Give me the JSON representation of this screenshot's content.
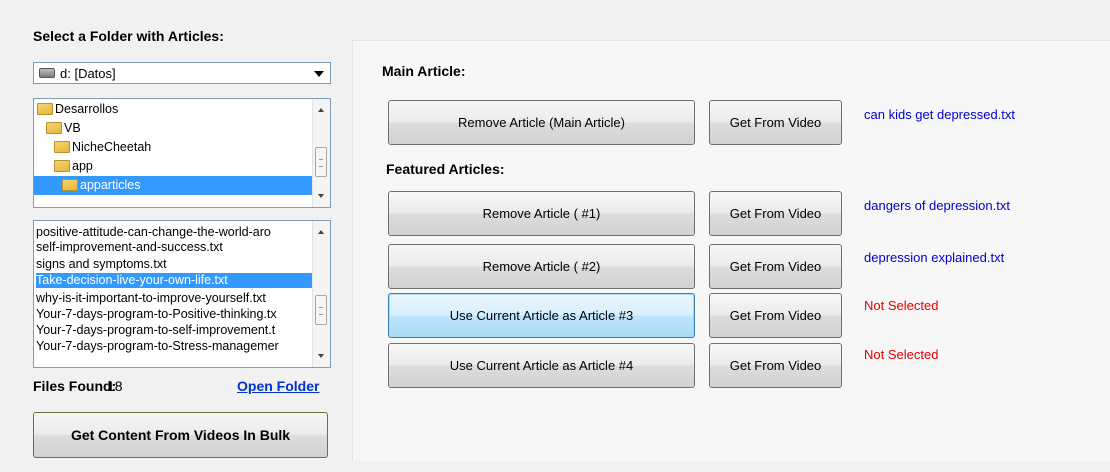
{
  "left": {
    "folder_title": "Select a Folder with Articles:",
    "drive": "d: [Datos]",
    "folders": [
      "Desarrollos",
      "VB",
      "NicheCheetah",
      "app",
      "apparticles"
    ],
    "files": [
      "positive-attitude-can-change-the-world-aro",
      "self-improvement-and-success.txt",
      "signs and symptoms.txt",
      "Take-decision-live-your-own-life.txt",
      "why-is-it-important-to-improve-yourself.txt",
      "Your-7-days-program-to-Positive-thinking.tx",
      "Your-7-days-program-to-self-improvement.t",
      "Your-7-days-program-to-Stress-managemer"
    ],
    "files_found_label": "Files Found:",
    "files_found_count": "18",
    "open_folder": "Open Folder",
    "bulk_button": "Get Content From Videos In Bulk"
  },
  "right": {
    "main_heading": "Main Article:",
    "featured_heading": "Featured Articles:",
    "rows": [
      {
        "action": "Remove Article (Main Article)",
        "video": "Get From Video",
        "status": "can kids get depressed.txt"
      },
      {
        "action": "Remove Article ( #1)",
        "video": "Get From Video",
        "status": "dangers of depression.txt"
      },
      {
        "action": "Remove Article ( #2)",
        "video": "Get From Video",
        "status": "depression explained.txt"
      },
      {
        "action": "Use Current Article as Article #3",
        "video": "Get From Video",
        "status": "Not Selected"
      },
      {
        "action": "Use Current Article as Article #4",
        "video": "Get From Video",
        "status": "Not Selected"
      }
    ]
  },
  "colors": {
    "selection": "#3399ff",
    "link": "#0033cc",
    "status_selected": "#0000cc",
    "status_not_selected": "#e60000"
  }
}
